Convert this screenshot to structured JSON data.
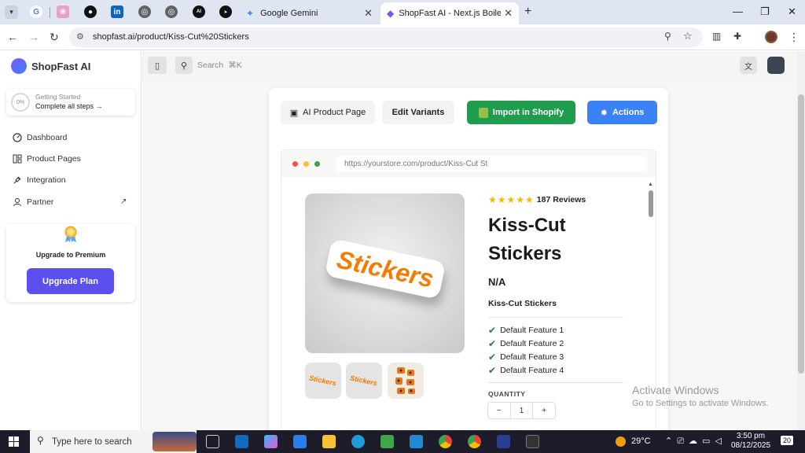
{
  "browser": {
    "tabs": [
      {
        "label": "Google Gemini"
      },
      {
        "label": "ShopFast AI - Next.js Boilerplate"
      }
    ],
    "url": "shopfast.ai/product/Kiss-Cut%20Stickers"
  },
  "sidebar": {
    "brand": "ShopFast AI",
    "getting_started": {
      "percent": "0%",
      "title": "Getting Started",
      "subtitle": "Complete all steps"
    },
    "items": [
      {
        "label": "Dashboard"
      },
      {
        "label": "Product Pages"
      },
      {
        "label": "Integration"
      },
      {
        "label": "Partner"
      }
    ],
    "premium": {
      "title": "Upgrade to Premium",
      "button": "Upgrade Plan"
    }
  },
  "topbar": {
    "search_placeholder": "Search",
    "shortcut": "⌘K"
  },
  "toolbar": {
    "ai_product_page": "AI Product Page",
    "edit_variants": "Edit Variants",
    "import_shopify": "Import in Shopify",
    "actions": "Actions"
  },
  "preview": {
    "url": "https://yourstore.com/product/Kiss-Cut St",
    "reviews": "187 Reviews",
    "rating": 5,
    "title_line1": "Kiss-Cut",
    "title_line2": "Stickers",
    "price": "N/A",
    "subtitle": "Kiss-Cut Stickers",
    "features": [
      "Default Feature 1",
      "Default Feature 2",
      "Default Feature 3",
      "Default Feature 4"
    ],
    "quantity_label": "QUANTITY",
    "quantity_value": "1",
    "sticker_text": "Stickers"
  },
  "watermark": {
    "title": "Activate Windows",
    "subtitle": "Go to Settings to activate Windows."
  },
  "taskbar": {
    "search": "Type here to search",
    "weather": "29°C",
    "time": "3:50 pm",
    "date": "08/12/2025",
    "notifications": "20"
  },
  "colors": {
    "green": "#1f9d4d",
    "blue": "#3b82f6",
    "purple": "#5b4ff0"
  }
}
